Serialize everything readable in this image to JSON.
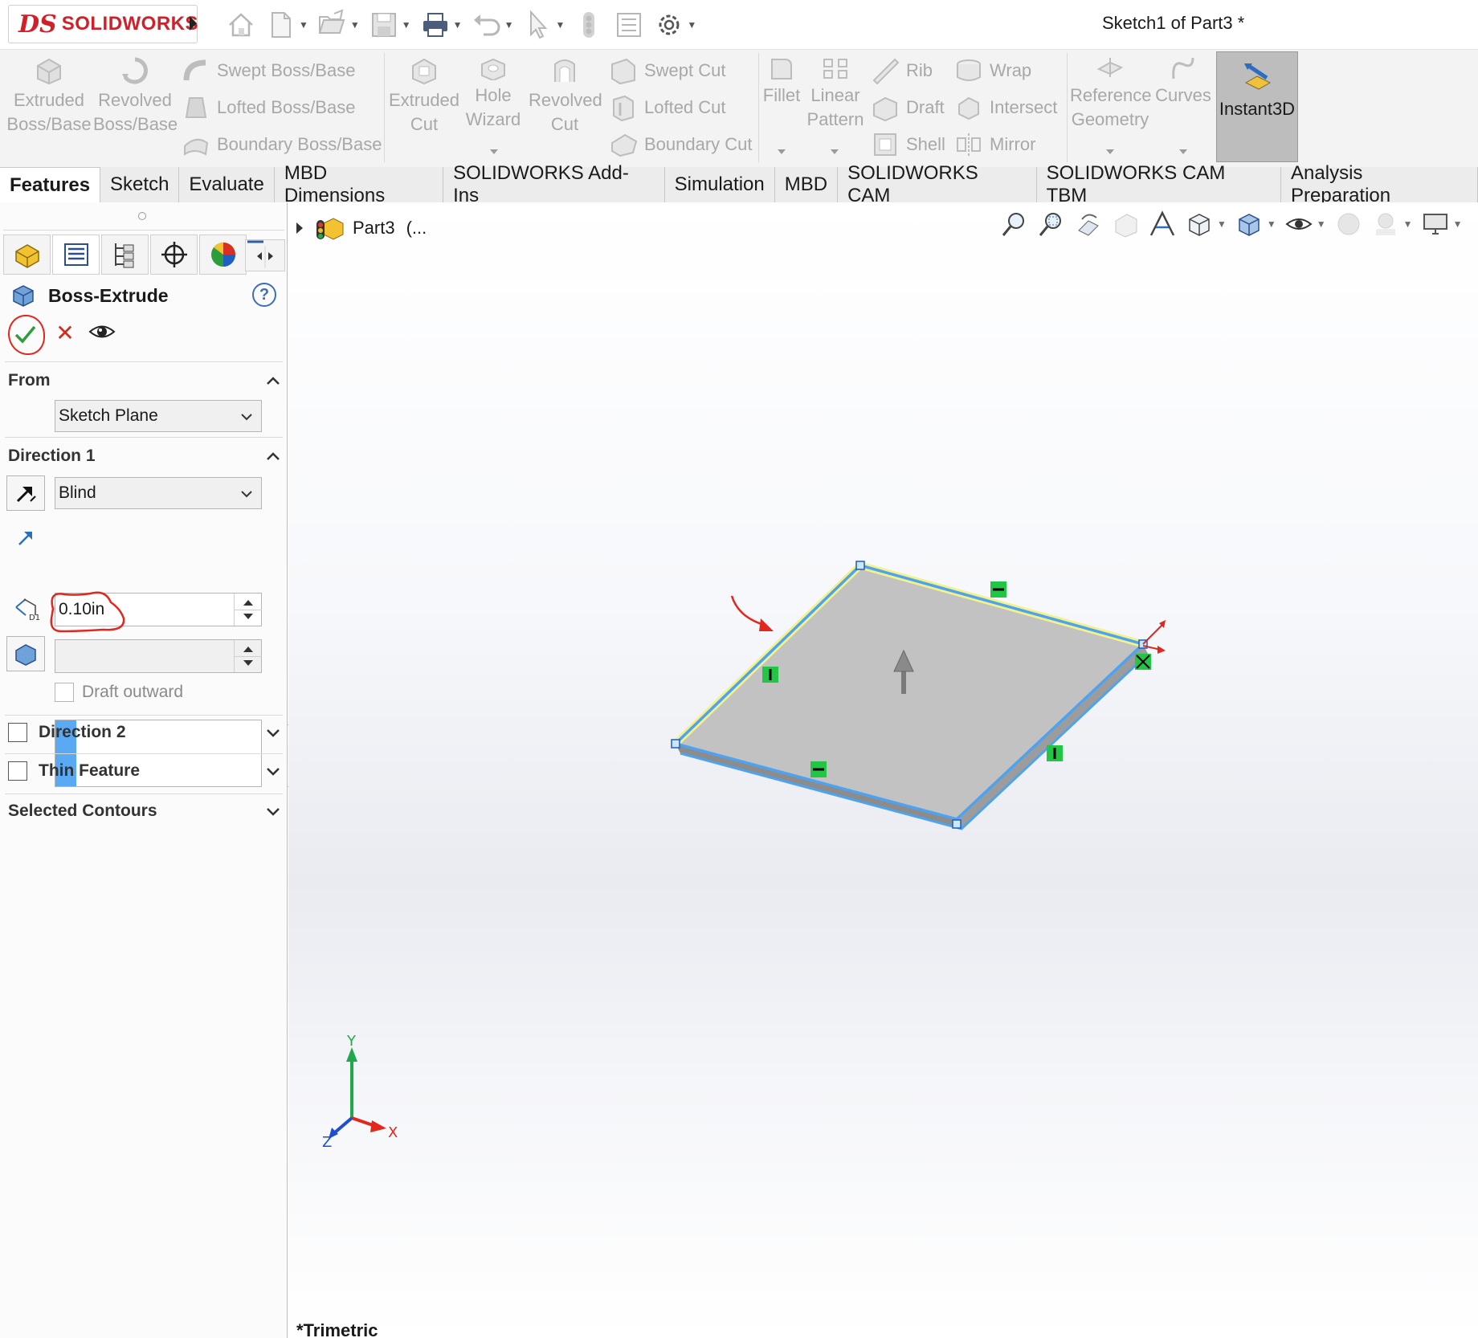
{
  "app": {
    "logo_mark": "DS",
    "logo_text": "SOLIDWORKS",
    "document_title": "Sketch1 of Part3 *"
  },
  "quick_access": [
    {
      "name": "home-icon",
      "dropdown": false
    },
    {
      "name": "new-document-icon",
      "dropdown": true
    },
    {
      "name": "open-folder-icon",
      "dropdown": true
    },
    {
      "name": "save-icon",
      "dropdown": true
    },
    {
      "name": "print-icon",
      "dropdown": true
    },
    {
      "name": "undo-icon",
      "dropdown": true
    },
    {
      "name": "select-arrow-icon",
      "dropdown": true
    },
    {
      "name": "traffic-light-icon",
      "dropdown": false
    },
    {
      "name": "file-properties-icon",
      "dropdown": false
    },
    {
      "name": "options-gear-icon",
      "dropdown": true
    }
  ],
  "ribbon": {
    "extruded_boss": "Extruded\nBoss/Base",
    "revolved_boss": "Revolved\nBoss/Base",
    "swept_boss": "Swept Boss/Base",
    "lofted_boss": "Lofted Boss/Base",
    "boundary_boss": "Boundary Boss/Base",
    "extruded_cut": "Extruded\nCut",
    "hole_wizard": "Hole\nWizard",
    "revolved_cut": "Revolved\nCut",
    "swept_cut": "Swept Cut",
    "lofted_cut": "Lofted Cut",
    "boundary_cut": "Boundary Cut",
    "fillet": "Fillet",
    "linear_pattern": "Linear\nPattern",
    "rib": "Rib",
    "draft": "Draft",
    "shell": "Shell",
    "wrap": "Wrap",
    "intersect": "Intersect",
    "mirror": "Mirror",
    "reference_geometry": "Reference\nGeometry",
    "curves": "Curves",
    "instant3d": "Instant3D"
  },
  "command_tabs": [
    {
      "label": "Features",
      "active": true
    },
    {
      "label": "Sketch",
      "active": false
    },
    {
      "label": "Evaluate",
      "active": false
    },
    {
      "label": "MBD Dimensions",
      "active": false
    },
    {
      "label": "SOLIDWORKS Add-Ins",
      "active": false
    },
    {
      "label": "Simulation",
      "active": false
    },
    {
      "label": "MBD",
      "active": false
    },
    {
      "label": "SOLIDWORKS CAM",
      "active": false
    },
    {
      "label": "SOLIDWORKS CAM TBM",
      "active": false
    },
    {
      "label": "Analysis Preparation",
      "active": false
    }
  ],
  "property_manager": {
    "title": "Boss-Extrude",
    "help": "?",
    "from": {
      "heading": "From",
      "value": "Sketch Plane"
    },
    "direction1": {
      "heading": "Direction 1",
      "end_condition": "Blind",
      "depth": "0.10in",
      "depth_label": "D1",
      "draft_outward": "Draft outward"
    },
    "direction2": {
      "heading": "Direction 2",
      "checked": false
    },
    "thin_feature": {
      "heading": "Thin Feature",
      "checked": false
    },
    "selected_contours": {
      "heading": "Selected Contours"
    }
  },
  "graphics": {
    "tree_node": "Part3",
    "tree_suffix": "(...",
    "view_orientation": "*Trimetric",
    "triad": {
      "x": "X",
      "y": "Y",
      "z": "Z"
    }
  },
  "colors": {
    "accent_red": "#d0202a",
    "annotation_red": "#e0281e",
    "sketch_blue": "#4da3f0",
    "highlight_yellow": "#f3f18a",
    "face_gray": "#c2c2c2",
    "relation_green": "#22c544"
  }
}
